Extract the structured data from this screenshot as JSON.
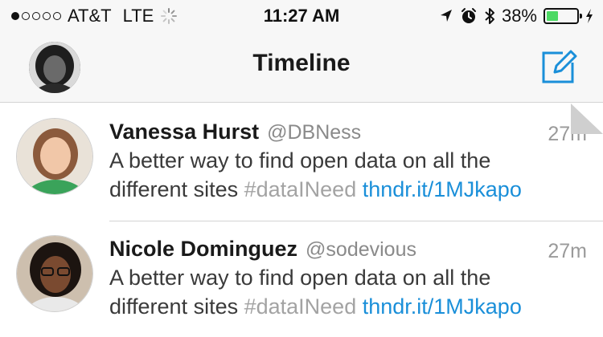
{
  "status_bar": {
    "carrier": "AT&T",
    "network": "LTE",
    "time": "11:27 AM",
    "battery": "38%",
    "battery_level": 0.38,
    "signal_bars_filled": 1,
    "signal_bars_total": 5,
    "colors": {
      "battery_fill": "#4cd964"
    }
  },
  "nav": {
    "title": "Timeline"
  },
  "tweets": [
    {
      "name": "Vanessa Hurst",
      "handle": "@DBNess",
      "time": "27m",
      "text_line1": "A better way to find open data on all the",
      "text_line2_plain": "different sites ",
      "hashtag": "#dataINeed",
      "link": "thndr.it/1MJkapo"
    },
    {
      "name": "Nicole Dominguez",
      "handle": "@sodevious",
      "time": "27m",
      "text_line1": "A better way to find open data on all the",
      "text_line2_plain": "different sites ",
      "hashtag": "#dataINeed",
      "link": "thndr.it/1MJkapo"
    }
  ],
  "colors": {
    "link": "#1a8fd9",
    "accent": "#1a8fd9"
  }
}
